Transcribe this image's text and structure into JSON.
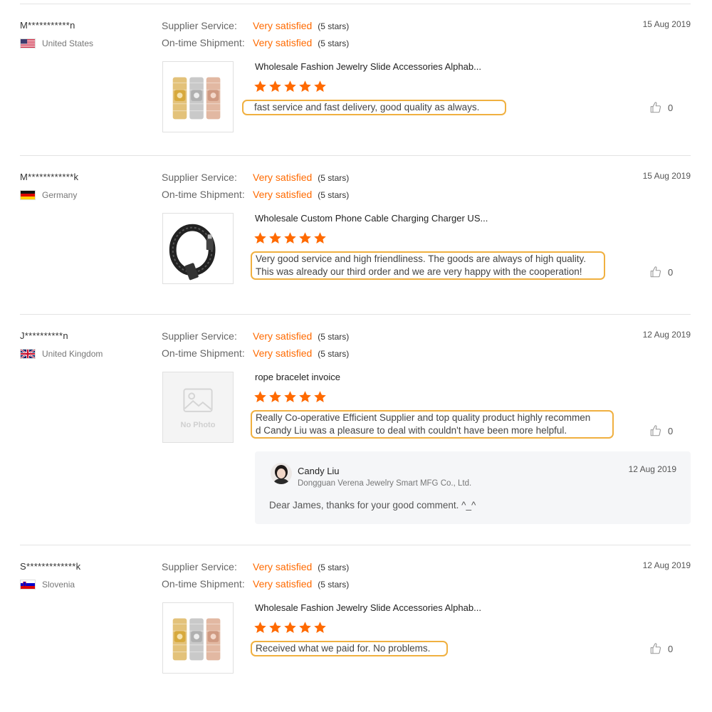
{
  "reviews": [
    {
      "user": "M***********n",
      "country": "United States",
      "flag": "us-flag-icon",
      "supplier_service_label": "Supplier Service:",
      "supplier_service_value": "Very satisfied",
      "supplier_service_stars": "(5 stars)",
      "shipment_label": "On-time Shipment:",
      "shipment_value": "Very satisfied",
      "shipment_stars": "(5 stars)",
      "date": "15 Aug 2019",
      "product_title": "Wholesale Fashion Jewelry Slide Accessories Alphab...",
      "product_image": "mesh-bracelets-image",
      "rating": 5,
      "comment_lines": [
        "fast service and fast delivery, good quality as always."
      ],
      "likes": "0"
    },
    {
      "user": "M************k",
      "country": "Germany",
      "flag": "de-flag-icon",
      "supplier_service_label": "Supplier Service:",
      "supplier_service_value": "Very satisfied",
      "supplier_service_stars": "(5 stars)",
      "shipment_label": "On-time Shipment:",
      "shipment_value": "Very satisfied",
      "shipment_stars": "(5 stars)",
      "date": "15 Aug 2019",
      "product_title": "Wholesale Custom Phone Cable Charging Charger US...",
      "product_image": "leather-cable-bracelet-image",
      "rating": 5,
      "comment_lines": [
        "Very good service and high friendliness. The goods are always of high quality.",
        "This was already our third order and we are very happy with the cooperation!"
      ],
      "likes": "0"
    },
    {
      "user": "J**********n",
      "country": "United Kingdom",
      "flag": "uk-flag-icon",
      "supplier_service_label": "Supplier Service:",
      "supplier_service_value": "Very satisfied",
      "supplier_service_stars": "(5 stars)",
      "shipment_label": "On-time Shipment:",
      "shipment_value": "Very satisfied",
      "shipment_stars": "(5 stars)",
      "date": "12 Aug 2019",
      "product_title": "rope bracelet invoice",
      "product_image": "no-photo-placeholder",
      "no_photo_text": "No Photo",
      "rating": 5,
      "comment_lines": [
        "Really Co-operative Efficient Supplier and top quality product highly recommen",
        "d Candy Liu was a pleasure to deal with couldn't have been more helpful."
      ],
      "likes": "0",
      "reply": {
        "name": "Candy Liu",
        "company": "Dongguan Verena Jewelry Smart MFG Co., Ltd.",
        "date": "12 Aug 2019",
        "text": "Dear James, thanks for your good comment. ^_^"
      }
    },
    {
      "user": "S*************k",
      "country": "Slovenia",
      "flag": "si-flag-icon",
      "supplier_service_label": "Supplier Service:",
      "supplier_service_value": "Very satisfied",
      "supplier_service_stars": "(5 stars)",
      "shipment_label": "On-time Shipment:",
      "shipment_value": "Very satisfied",
      "shipment_stars": "(5 stars)",
      "date": "12 Aug 2019",
      "product_title": "Wholesale Fashion Jewelry Slide Accessories Alphab...",
      "product_image": "mesh-bracelets-image",
      "rating": 5,
      "comment_lines": [
        "Received what we paid for. No problems."
      ],
      "likes": "0"
    }
  ],
  "colors": {
    "accent": "#ff6a00",
    "highlight_border": "#f0b040",
    "divider": "#e3e3e3"
  }
}
